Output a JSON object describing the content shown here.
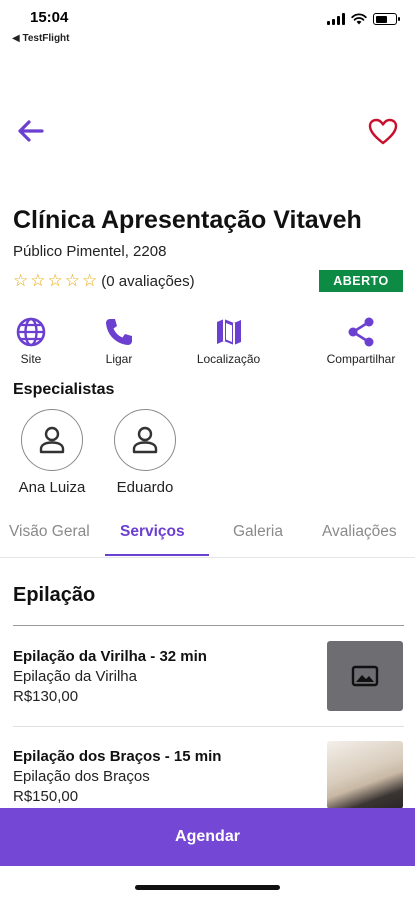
{
  "status_bar": {
    "time": "15:04",
    "back_app": "◀ TestFlight"
  },
  "header": {
    "back_icon": "arrow-left-icon",
    "favorite_icon": "heart-icon",
    "accent_color": "#6b3fd0",
    "heart_color": "#c8102e"
  },
  "clinic": {
    "title": "Clínica Apresentação Vitaveh",
    "address": "Público Pimentel, 2208",
    "rating_stars": 0,
    "rating_text": "(0 avaliações)",
    "status_badge": "ABERTO",
    "status_color": "#0d8a43"
  },
  "actions": [
    {
      "label": "Site",
      "icon": "globe-icon"
    },
    {
      "label": "Ligar",
      "icon": "phone-icon"
    },
    {
      "label": "Localização",
      "icon": "map-icon"
    },
    {
      "label": "Compartilhar",
      "icon": "share-icon"
    }
  ],
  "specialists": {
    "title": "Especialistas",
    "items": [
      {
        "name": "Ana Luiza",
        "icon": "user-icon"
      },
      {
        "name": "Eduardo",
        "icon": "user-icon"
      }
    ]
  },
  "tabs": [
    {
      "label": "Visão Geral",
      "active": false
    },
    {
      "label": "Serviços",
      "active": true
    },
    {
      "label": "Galeria",
      "active": false
    },
    {
      "label": "Avaliações",
      "active": false
    }
  ],
  "services_section": {
    "title": "Epilação",
    "items": [
      {
        "name": "Epilação da Virilha - 32 min",
        "description": "Epilação da Virilha",
        "price": "R$130,00",
        "image": "image-placeholder-icon"
      },
      {
        "name": "Epilação dos Braços - 15 min",
        "description": "Epilação dos Braços",
        "price": "R$150,00",
        "image": "service-photo"
      }
    ]
  },
  "cta": {
    "label": "Agendar",
    "color": "#7447d4"
  }
}
